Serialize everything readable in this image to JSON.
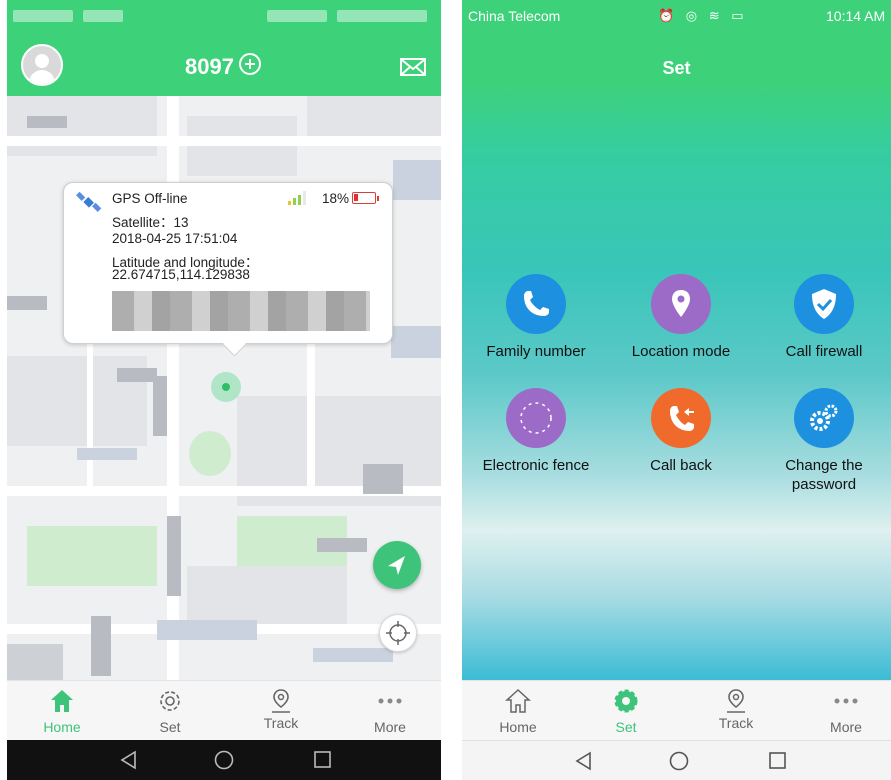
{
  "left": {
    "header": {
      "device_id": "8097"
    },
    "popup": {
      "status": "GPS   Off-line",
      "battery": "18%",
      "satellite": "Satellite：13",
      "datetime": "2018-04-25 17:51:04",
      "latlng_label": "Latitude and longitude：",
      "latlng": "22.674715,114.129838"
    },
    "tabs": [
      {
        "label": "Home",
        "icon": "home-icon",
        "active": true
      },
      {
        "label": "Set",
        "icon": "gear-icon",
        "active": false
      },
      {
        "label": "Track",
        "icon": "track-pin-icon",
        "active": false
      },
      {
        "label": "More",
        "icon": "more-dots-icon",
        "active": false
      }
    ]
  },
  "right": {
    "status": {
      "carrier": "China Telecom",
      "time": "10:14 AM"
    },
    "title": "Set",
    "menu": [
      {
        "label": "Family number",
        "icon": "phone-icon",
        "color": "#1e90e0"
      },
      {
        "label": "Location mode",
        "icon": "location-pin-icon",
        "color": "#9b6bc7"
      },
      {
        "label": "Call firewall",
        "icon": "shield-check-icon",
        "color": "#1e90e0"
      },
      {
        "label": "Electronic fence",
        "icon": "fence-circle-icon",
        "color": "#9b6bc7"
      },
      {
        "label": "Call back",
        "icon": "callback-icon",
        "color": "#f06a2c"
      },
      {
        "label": "Change the password",
        "icon": "gears-icon",
        "color": "#1e90e0"
      }
    ],
    "tabs": [
      {
        "label": "Home",
        "icon": "home-icon",
        "active": false
      },
      {
        "label": "Set",
        "icon": "gear-icon",
        "active": true
      },
      {
        "label": "Track",
        "icon": "track-pin-icon",
        "active": false
      },
      {
        "label": "More",
        "icon": "more-dots-icon",
        "active": false
      }
    ]
  },
  "colors": {
    "brand": "#3dd27a",
    "active_tab": "#3dc47a"
  }
}
